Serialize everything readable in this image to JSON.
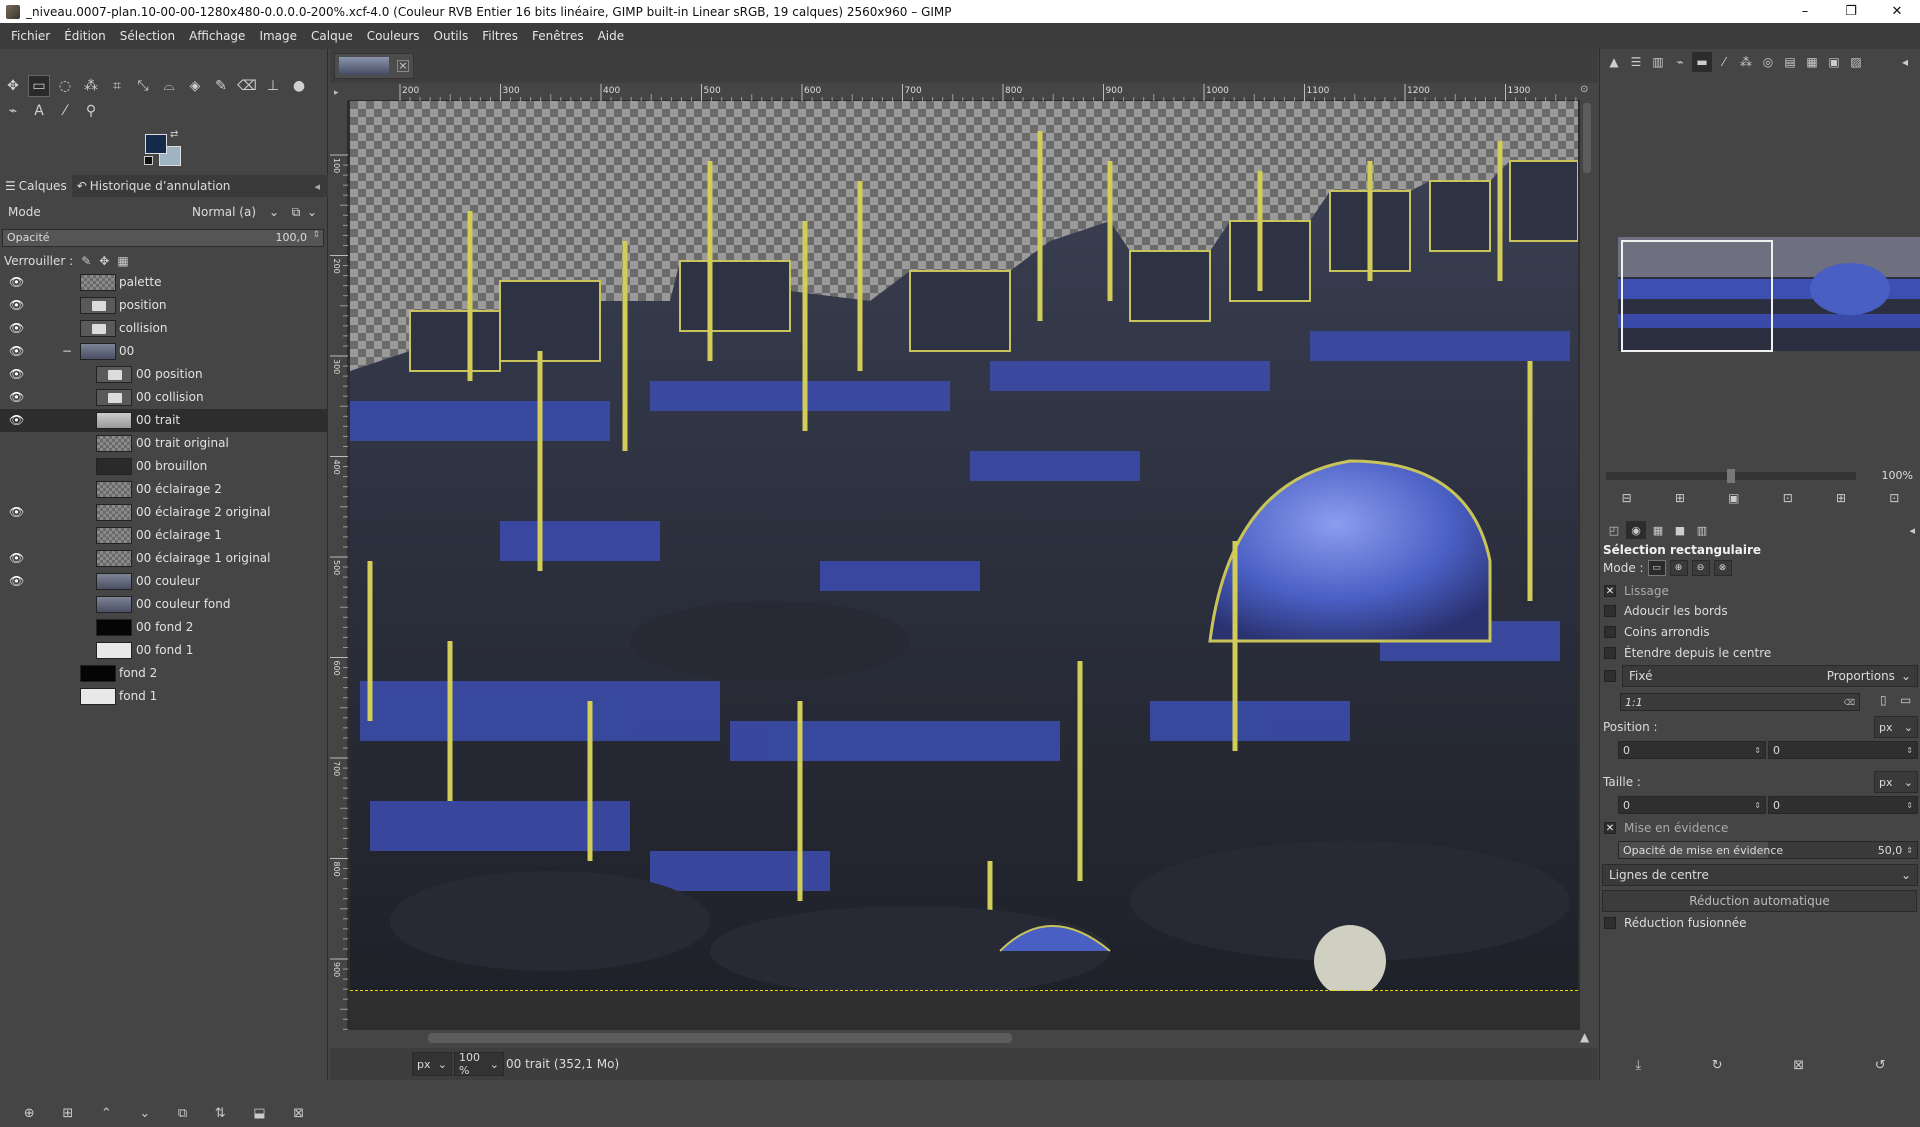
{
  "window": {
    "title": "_niveau.0007-plan.10-00-00-1280x480-0.0.0.0-200%.xcf-4.0 (Couleur RVB Entier 16 bits linéaire, GIMP built-in Linear sRGB, 19 calques) 2560x960 – GIMP",
    "minimize": "–",
    "maximize": "❐",
    "close": "✕"
  },
  "menu": [
    "Fichier",
    "Édition",
    "Sélection",
    "Affichage",
    "Image",
    "Calque",
    "Couleurs",
    "Outils",
    "Filtres",
    "Fenêtres",
    "Aide"
  ],
  "colors": {
    "foreground": "#132a4a",
    "background": "#9fb4c2"
  },
  "layers_panel": {
    "tab_layers": "Calques",
    "tab_history": "Historique d’annulation",
    "mode_label": "Mode",
    "mode_value": "Normal (a)",
    "opacity_label": "Opacité",
    "opacity_value": "100,0",
    "opacity_fraction": 1.0,
    "lock_label": "Verrouiller :"
  },
  "layers": [
    {
      "name": "palette",
      "visible": true,
      "thumb": "check",
      "indent": 0
    },
    {
      "name": "position",
      "visible": true,
      "thumb": "folder",
      "indent": 0
    },
    {
      "name": "collision",
      "visible": true,
      "thumb": "folder",
      "indent": 0
    },
    {
      "name": "00",
      "visible": true,
      "thumb": "city",
      "indent": 0,
      "group": true
    },
    {
      "name": "00 position",
      "visible": true,
      "thumb": "folder",
      "indent": 1
    },
    {
      "name": "00 collision",
      "visible": true,
      "thumb": "folder",
      "indent": 1
    },
    {
      "name": "00 trait",
      "visible": true,
      "thumb": "trait",
      "indent": 1,
      "selected": true
    },
    {
      "name": "00 trait original",
      "visible": false,
      "thumb": "check",
      "indent": 1
    },
    {
      "name": "00 brouillon",
      "visible": false,
      "thumb": "sketch",
      "indent": 1
    },
    {
      "name": "00 éclairage 2",
      "visible": false,
      "thumb": "check",
      "indent": 1
    },
    {
      "name": "00 éclairage 2 original",
      "visible": true,
      "thumb": "check",
      "indent": 1
    },
    {
      "name": "00 éclairage 1",
      "visible": false,
      "thumb": "check",
      "indent": 1
    },
    {
      "name": "00 éclairage 1 original",
      "visible": true,
      "thumb": "check",
      "indent": 1
    },
    {
      "name": "00 couleur",
      "visible": true,
      "thumb": "city",
      "indent": 1
    },
    {
      "name": "00 couleur fond",
      "visible": false,
      "thumb": "city",
      "indent": 1
    },
    {
      "name": "00 fond 2",
      "visible": false,
      "thumb": "black",
      "indent": 1
    },
    {
      "name": "00 fond 1",
      "visible": false,
      "thumb": "white",
      "indent": 1
    },
    {
      "name": "fond 2",
      "visible": false,
      "thumb": "black",
      "indent": 0
    },
    {
      "name": "fond 1",
      "visible": false,
      "thumb": "white",
      "indent": 0
    }
  ],
  "ruler": {
    "h_ticks": [
      "200",
      "300",
      "400",
      "500",
      "600",
      "700",
      "800",
      "900",
      "1000",
      "1100",
      "1200",
      "1300"
    ],
    "v_ticks": [
      "100",
      "200",
      "300",
      "400",
      "500",
      "600",
      "700",
      "800",
      "900"
    ]
  },
  "statusbar": {
    "unit": "px",
    "zoom": "100 %",
    "message": "00 trait (352,1 Mo)"
  },
  "navigation": {
    "zoom": "100%",
    "zoom_fraction": 0.5
  },
  "tool_options": {
    "title": "Sélection rectangulaire",
    "mode_label": "Mode :",
    "antialias": {
      "label": "Lissage",
      "checked": true
    },
    "feather": {
      "label": "Adoucir les bords",
      "checked": false
    },
    "rounded": {
      "label": "Coins arrondis",
      "checked": false
    },
    "expand_center": {
      "label": "Étendre depuis le centre",
      "checked": false
    },
    "fixed": {
      "label": "Fixé",
      "checked": false,
      "dropdown": "Proportions"
    },
    "ratio": "1:1",
    "position_label": "Position :",
    "position_unit": "px",
    "position_x": "0",
    "position_y": "0",
    "size_label": "Taille :",
    "size_unit": "px",
    "size_w": "0",
    "size_h": "0",
    "highlight": {
      "label": "Mise en évidence",
      "checked": true
    },
    "highlight_opacity_label": "Opacité de mise en évidence",
    "highlight_opacity_value": "50,0",
    "highlight_opacity_fraction": 0.5,
    "guides": "Lignes de centre",
    "auto_shrink": "Réduction automatique",
    "shrink_merged": {
      "label": "Réduction fusionnée",
      "checked": false
    }
  }
}
